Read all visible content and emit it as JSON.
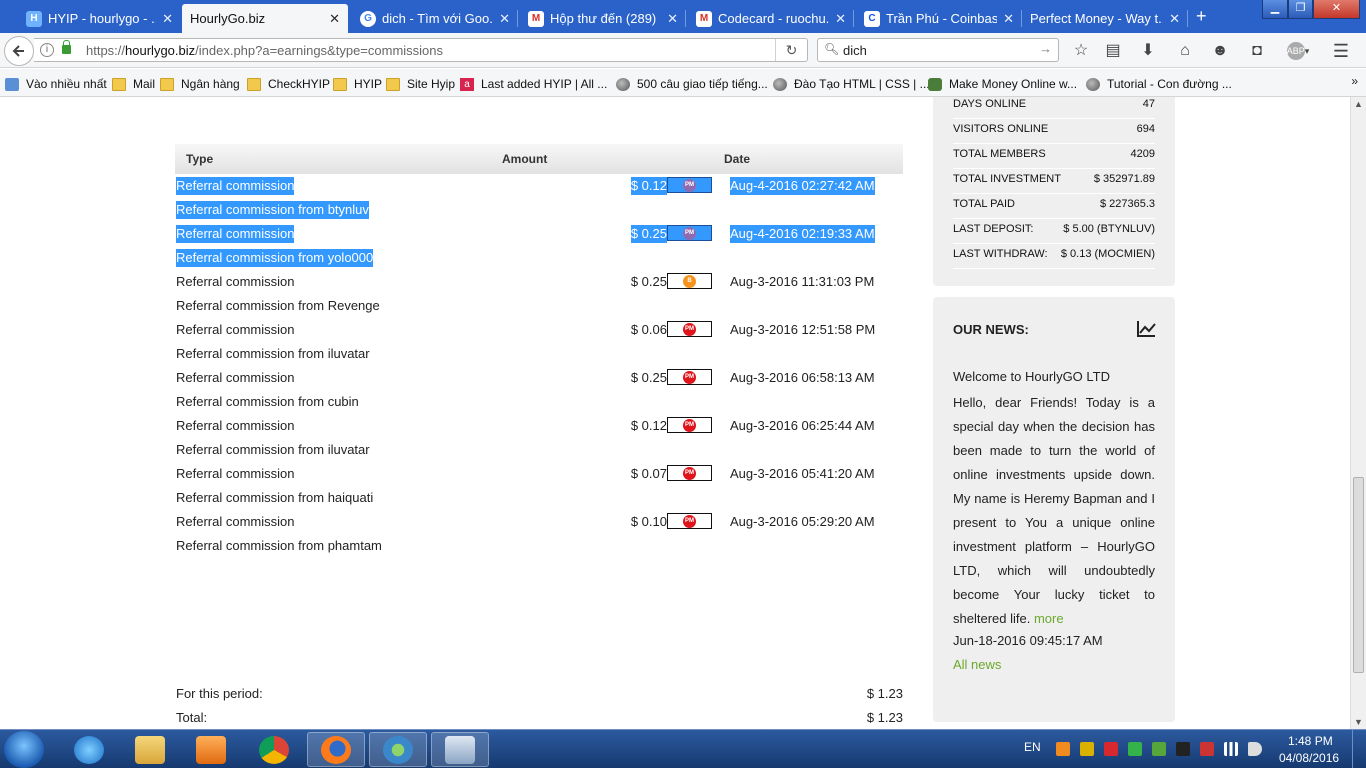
{
  "browser": {
    "tabs": [
      {
        "title": "HYIP - hourlygo - ...",
        "icon": "hyip-favicon",
        "active": false
      },
      {
        "title": "HourlyGo.biz",
        "icon": "none",
        "active": true
      },
      {
        "title": "dich - Tìm với Goo...",
        "icon": "google-favicon",
        "active": false
      },
      {
        "title": "Hộp thư đến (289) ...",
        "icon": "gmail-favicon",
        "active": false
      },
      {
        "title": "Codecard - ruochu...",
        "icon": "gmail-favicon",
        "active": false
      },
      {
        "title": "Trần Phú - Coinbase",
        "icon": "coinbase-favicon",
        "active": false
      },
      {
        "title": "Perfect Money - Way t...",
        "icon": "none",
        "active": false
      }
    ],
    "new_tab": "+",
    "url_prefix": "https://",
    "url_host": "hourlygo.biz",
    "url_path": "/index.php?a=earnings&type=commissions",
    "search_value": "dich",
    "bookmarks": [
      {
        "label": "Vào nhiều nhất",
        "icon": "star"
      },
      {
        "label": "Mail",
        "icon": "folder"
      },
      {
        "label": "Ngân hàng",
        "icon": "folder"
      },
      {
        "label": "CheckHYIP",
        "icon": "folder"
      },
      {
        "label": "HYIP",
        "icon": "folder"
      },
      {
        "label": "Site Hyip",
        "icon": "folder"
      },
      {
        "label": "Last added HYIP | All ...",
        "icon": "a-logo"
      },
      {
        "label": "500 câu giao tiếp tiếng...",
        "icon": "globe"
      },
      {
        "label": "Đào Tạo HTML | CSS | ...",
        "icon": "globe"
      },
      {
        "label": "Make Money Online w...",
        "icon": "money"
      },
      {
        "label": "Tutorial - Con đường ...",
        "icon": "globe"
      }
    ],
    "bookmarks_more": "»"
  },
  "earnings": {
    "headers": {
      "type": "Type",
      "amount": "Amount",
      "date": "Date"
    },
    "rows": [
      {
        "type": "Referral commission",
        "amount": "$ 0.12",
        "processor": "PM",
        "date": "Aug-4-2016 02:27:42 AM",
        "desc": "Referral commission from btynluv",
        "selected": true
      },
      {
        "type": "Referral commission",
        "amount": "$ 0.25",
        "processor": "PM",
        "date": "Aug-4-2016 02:19:33 AM",
        "desc": "Referral commission from yolo000",
        "selected": true
      },
      {
        "type": "Referral commission",
        "amount": "$ 0.25",
        "processor": "B",
        "date": "Aug-3-2016 11:31:03 PM",
        "desc": "Referral commission from Revenge",
        "selected": false
      },
      {
        "type": "Referral commission",
        "amount": "$ 0.06",
        "processor": "PM",
        "date": "Aug-3-2016 12:51:58 PM",
        "desc": "Referral commission from iluvatar",
        "selected": false
      },
      {
        "type": "Referral commission",
        "amount": "$ 0.25",
        "processor": "PM",
        "date": "Aug-3-2016 06:58:13 AM",
        "desc": "Referral commission from cubin",
        "selected": false
      },
      {
        "type": "Referral commission",
        "amount": "$ 0.12",
        "processor": "PM",
        "date": "Aug-3-2016 06:25:44 AM",
        "desc": "Referral commission from iluvatar",
        "selected": false
      },
      {
        "type": "Referral commission",
        "amount": "$ 0.07",
        "processor": "PM",
        "date": "Aug-3-2016 05:41:20 AM",
        "desc": "Referral commission from haiquati",
        "selected": false
      },
      {
        "type": "Referral commission",
        "amount": "$ 0.10",
        "processor": "PM",
        "date": "Aug-3-2016 05:29:20 AM",
        "desc": "Referral commission from phamtam",
        "selected": false
      }
    ],
    "period_label": "For this period:",
    "period_value": "$ 1.23",
    "total_label": "Total:",
    "total_value": "$ 1.23"
  },
  "stats": [
    {
      "label": "DAYS ONLINE",
      "value": "47"
    },
    {
      "label": "VISITORS ONLINE",
      "value": "694"
    },
    {
      "label": "TOTAL MEMBERS",
      "value": "4209"
    },
    {
      "label": "TOTAL INVESTMENT",
      "value": "$ 352971.89"
    },
    {
      "label": "TOTAL PAID",
      "value": "$ 227365.3"
    },
    {
      "label": "LAST DEPOSIT:",
      "value": "$ 5.00 (BTYNLUV)"
    },
    {
      "label": "LAST WITHDRAW:",
      "value": "$ 0.13 (MOCMIEN)"
    }
  ],
  "news": {
    "title": "OUR NEWS:",
    "headline": "Welcome to HourlyGO LTD",
    "body": "Hello, dear Friends! Today is a special day when the decision has been made to turn the world of online investments upside down. My name is Heremy Bapman and I present to You a unique online investment platform – HourlyGO LTD, which will undoubtedly become Your lucky ticket to sheltered life.",
    "more": "more",
    "date": "Jun-18-2016 09:45:17 AM",
    "all_news": "All news"
  },
  "taskbar": {
    "lang": "EN",
    "time": "1:48 PM",
    "date": "04/08/2016"
  },
  "colors": {
    "selection": "#3399ff",
    "tabstrip": "#2a62c9",
    "link_green": "#6ba92d",
    "pm_red": "#e0141b",
    "pm_selected": "#8e6bb0",
    "bitcoin": "#f7931a"
  }
}
